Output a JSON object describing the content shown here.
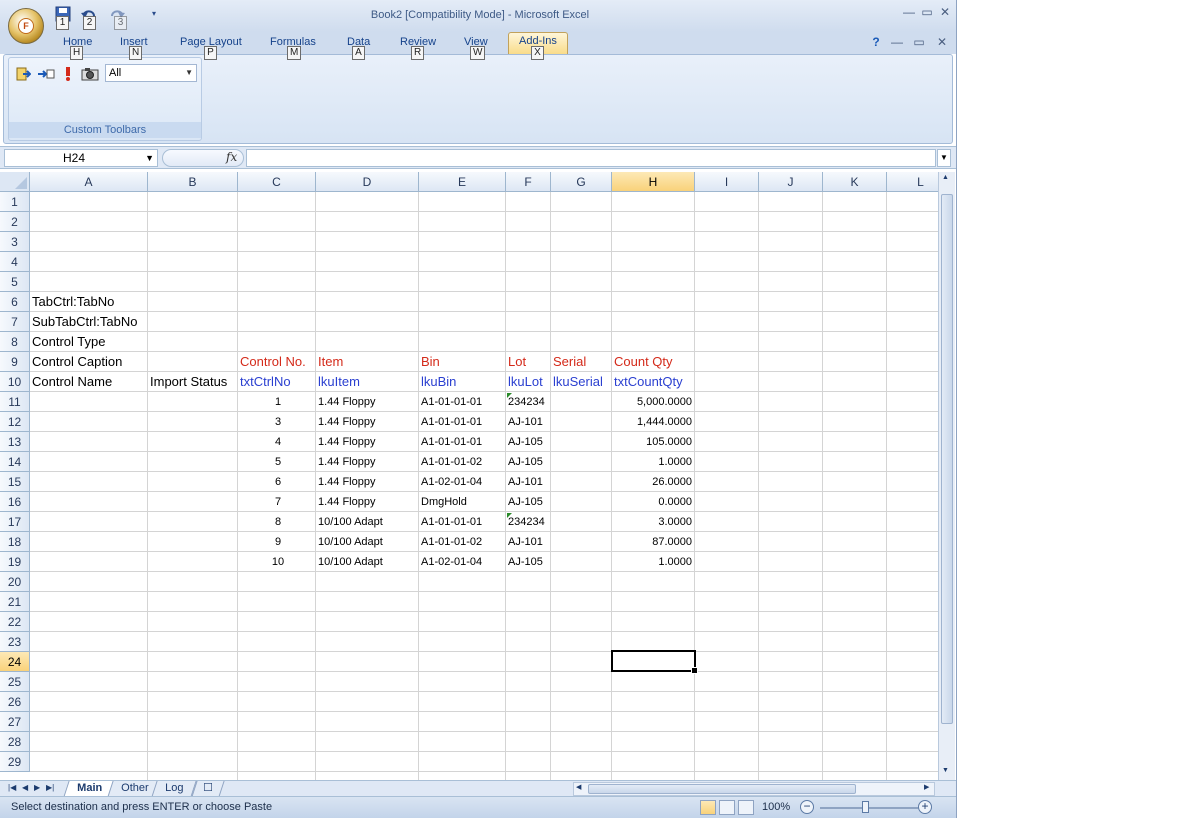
{
  "window": {
    "title": "Book2  [Compatibility Mode] - Microsoft Excel"
  },
  "office_button": {
    "key": "F"
  },
  "qat_keytips": [
    "1",
    "2",
    "3"
  ],
  "ribbon_tabs": [
    {
      "label": "Home",
      "key": "H"
    },
    {
      "label": "Insert",
      "key": "N"
    },
    {
      "label": "Page Layout",
      "key": "P"
    },
    {
      "label": "Formulas",
      "key": "M"
    },
    {
      "label": "Data",
      "key": "A"
    },
    {
      "label": "Review",
      "key": "R"
    },
    {
      "label": "View",
      "key": "W"
    },
    {
      "label": "Add-Ins",
      "key": "X"
    }
  ],
  "custom_toolbars": {
    "select_value": "All",
    "group_label": "Custom Toolbars"
  },
  "formula_bar": {
    "name_box": "H24",
    "fx": "fx",
    "formula": ""
  },
  "columns": [
    "A",
    "B",
    "C",
    "D",
    "E",
    "F",
    "G",
    "H",
    "I",
    "J",
    "K",
    "L"
  ],
  "rows": [
    "1",
    "2",
    "3",
    "4",
    "5",
    "6",
    "7",
    "8",
    "9",
    "10",
    "11",
    "12",
    "13",
    "14",
    "15",
    "16",
    "17",
    "18",
    "19",
    "20",
    "21",
    "22",
    "23",
    "24",
    "25",
    "26",
    "27",
    "28",
    "29"
  ],
  "labels": {
    "tabctrl": "TabCtrl:TabNo",
    "subtabctrl": "SubTabCtrl:TabNo",
    "control_type": "Control Type",
    "control_caption": "Control Caption",
    "control_name": "Control Name",
    "import_status": "Import Status"
  },
  "captions": [
    "Control No.",
    "Item",
    "Bin",
    "Lot",
    "Serial",
    "Count Qty"
  ],
  "names": [
    "txtCtrlNo",
    "lkuItem",
    "lkuBin",
    "lkuLot",
    "lkuSerial",
    "txtCountQty"
  ],
  "data_rows": [
    {
      "ctrl": "1",
      "item": "1.44 Floppy",
      "bin": "A1-01-01-01",
      "lot": "234234",
      "serial": "",
      "qty": "5,000.0000"
    },
    {
      "ctrl": "3",
      "item": "1.44 Floppy",
      "bin": "A1-01-01-01",
      "lot": "AJ-101",
      "serial": "",
      "qty": "1,444.0000"
    },
    {
      "ctrl": "4",
      "item": "1.44 Floppy",
      "bin": "A1-01-01-01",
      "lot": "AJ-105",
      "serial": "",
      "qty": "105.0000"
    },
    {
      "ctrl": "5",
      "item": "1.44 Floppy",
      "bin": "A1-01-01-02",
      "lot": "AJ-105",
      "serial": "",
      "qty": "1.0000"
    },
    {
      "ctrl": "6",
      "item": "1.44 Floppy",
      "bin": "A1-02-01-04",
      "lot": "AJ-101",
      "serial": "",
      "qty": "26.0000"
    },
    {
      "ctrl": "7",
      "item": "1.44 Floppy",
      "bin": "DmgHold",
      "lot": "AJ-105",
      "serial": "",
      "qty": "0.0000"
    },
    {
      "ctrl": "8",
      "item": "10/100 Adapt",
      "bin": "A1-01-01-01",
      "lot": "234234",
      "serial": "",
      "qty": "3.0000"
    },
    {
      "ctrl": "9",
      "item": "10/100 Adapt",
      "bin": "A1-01-01-02",
      "lot": "AJ-101",
      "serial": "",
      "qty": "87.0000"
    },
    {
      "ctrl": "10",
      "item": "10/100 Adapt",
      "bin": "A1-02-01-04",
      "lot": "AJ-105",
      "serial": "",
      "qty": "1.0000"
    }
  ],
  "sheet_tabs": [
    "Main",
    "Other",
    "Log"
  ],
  "status": {
    "text": "Select destination and press ENTER or choose Paste",
    "zoom": "100%"
  },
  "colors": {
    "caption": "#d42a1a",
    "name": "#2a3fd0",
    "selection_header": "#f9d27a"
  }
}
